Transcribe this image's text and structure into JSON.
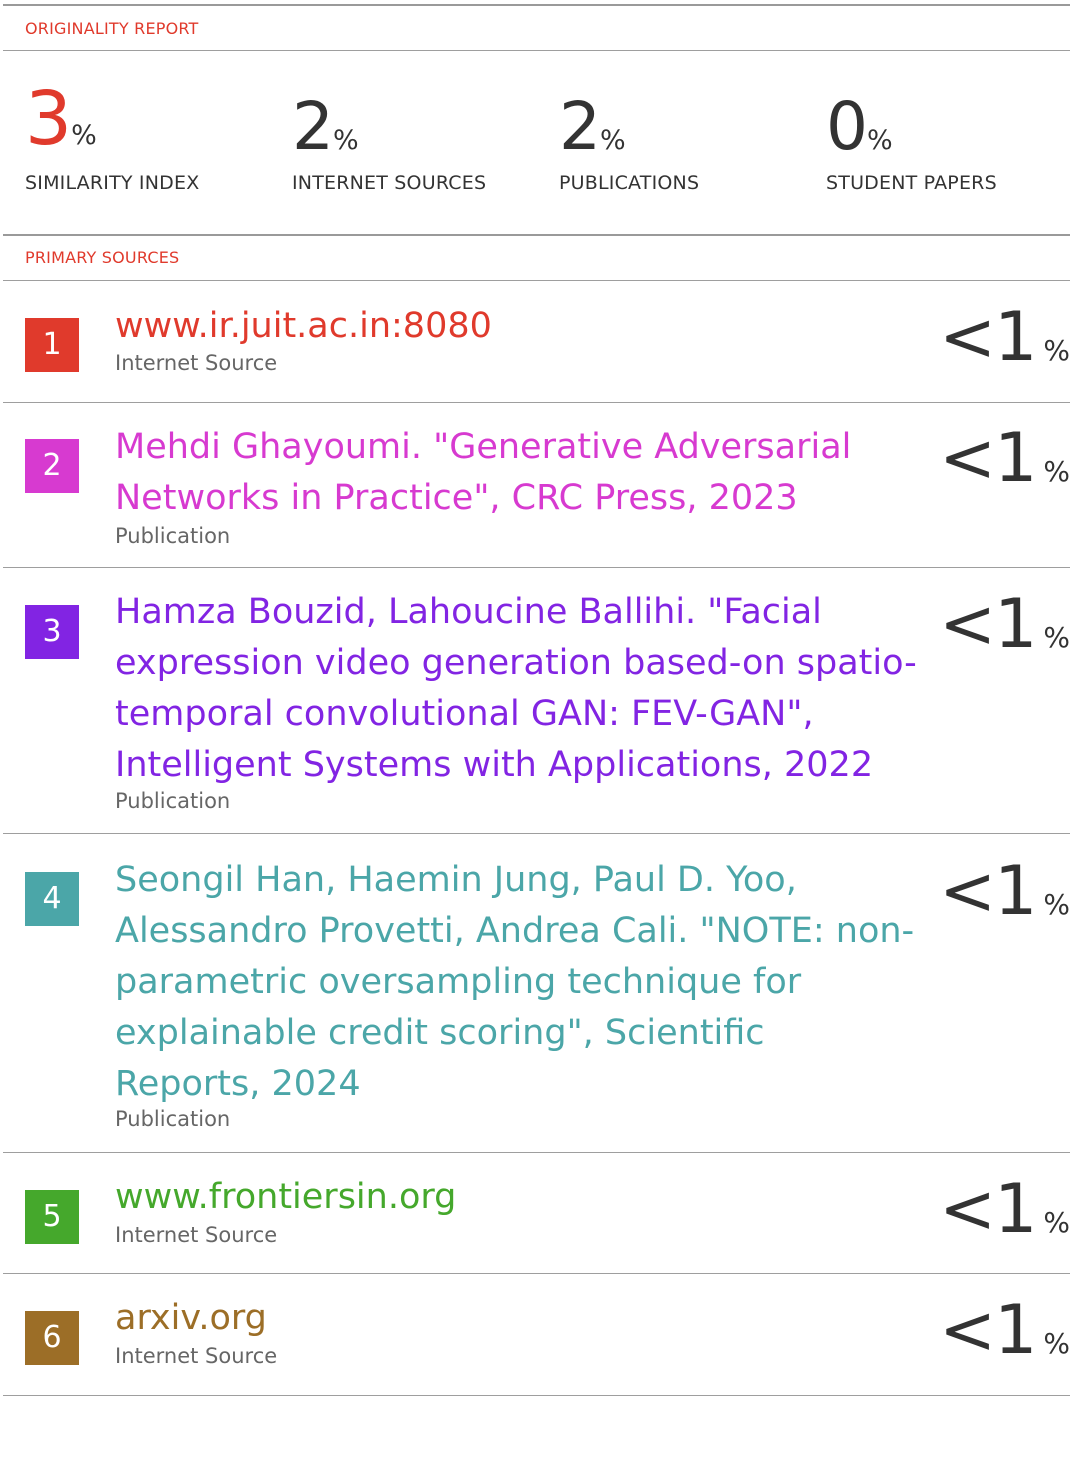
{
  "report": {
    "title": "ORIGINALITY REPORT",
    "primary_sources_title": "PRIMARY SOURCES"
  },
  "stats": {
    "similarity": {
      "value": "3",
      "unit": "%",
      "label": "SIMILARITY INDEX"
    },
    "internet": {
      "value": "2",
      "unit": "%",
      "label": "INTERNET SOURCES"
    },
    "publications": {
      "value": "2",
      "unit": "%",
      "label": "PUBLICATIONS"
    },
    "student": {
      "value": "0",
      "unit": "%",
      "label": "STUDENT PAPERS"
    }
  },
  "sources": [
    {
      "rank": "1",
      "title": "www.ir.juit.ac.in:8080",
      "type": "Internet Source",
      "match": "<1",
      "unit": "%",
      "color": "#e03a2c"
    },
    {
      "rank": "2",
      "title": "Mehdi Ghayoumi. \"Generative Adversarial Networks in Practice\", CRC Press, 2023",
      "type": "Publication",
      "match": "<1",
      "unit": "%",
      "color": "#d73ad0"
    },
    {
      "rank": "3",
      "title": "Hamza Bouzid, Lahoucine Ballihi. \"Facial expression video generation based-on spatio-temporal convolutional GAN: FEV-GAN\", Intelligent Systems with Applications, 2022",
      "type": "Publication",
      "match": "<1",
      "unit": "%",
      "color": "#8224e3"
    },
    {
      "rank": "4",
      "title": "Seongil Han, Haemin Jung, Paul D. Yoo, Alessandro Provetti, Andrea Cali. \"NOTE: non-parametric oversampling technique for explainable credit scoring\", Scientific Reports, 2024",
      "type": "Publication",
      "match": "<1",
      "unit": "%",
      "color": "#4ba6a8"
    },
    {
      "rank": "5",
      "title": "www.frontiersin.org",
      "type": "Internet Source",
      "match": "<1",
      "unit": "%",
      "color": "#45a82c"
    },
    {
      "rank": "6",
      "title": "arxiv.org",
      "type": "Internet Source",
      "match": "<1",
      "unit": "%",
      "color": "#9c6e27"
    }
  ]
}
